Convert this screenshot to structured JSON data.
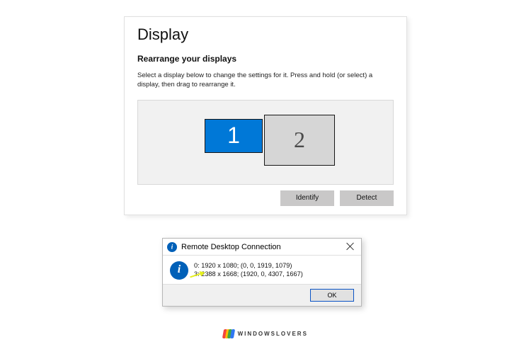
{
  "settings": {
    "title": "Display",
    "subheading": "Rearrange your displays",
    "instruction": "Select a display below to change the settings for it. Press and hold (or select) a display, then drag to rearrange it.",
    "displays": [
      {
        "number": "1",
        "selected": true
      },
      {
        "number": "2",
        "selected": false
      }
    ],
    "buttons": {
      "identify": "Identify",
      "detect": "Detect"
    }
  },
  "dialog": {
    "title": "Remote Desktop Connection",
    "lines": [
      "0: 1920 x 1080; (0, 0, 1919, 1079)",
      "3: 2388 x 1668; (1920, 0, 4307, 1667)"
    ],
    "ok": "OK"
  },
  "watermark": "WINDOWSLOVERS"
}
